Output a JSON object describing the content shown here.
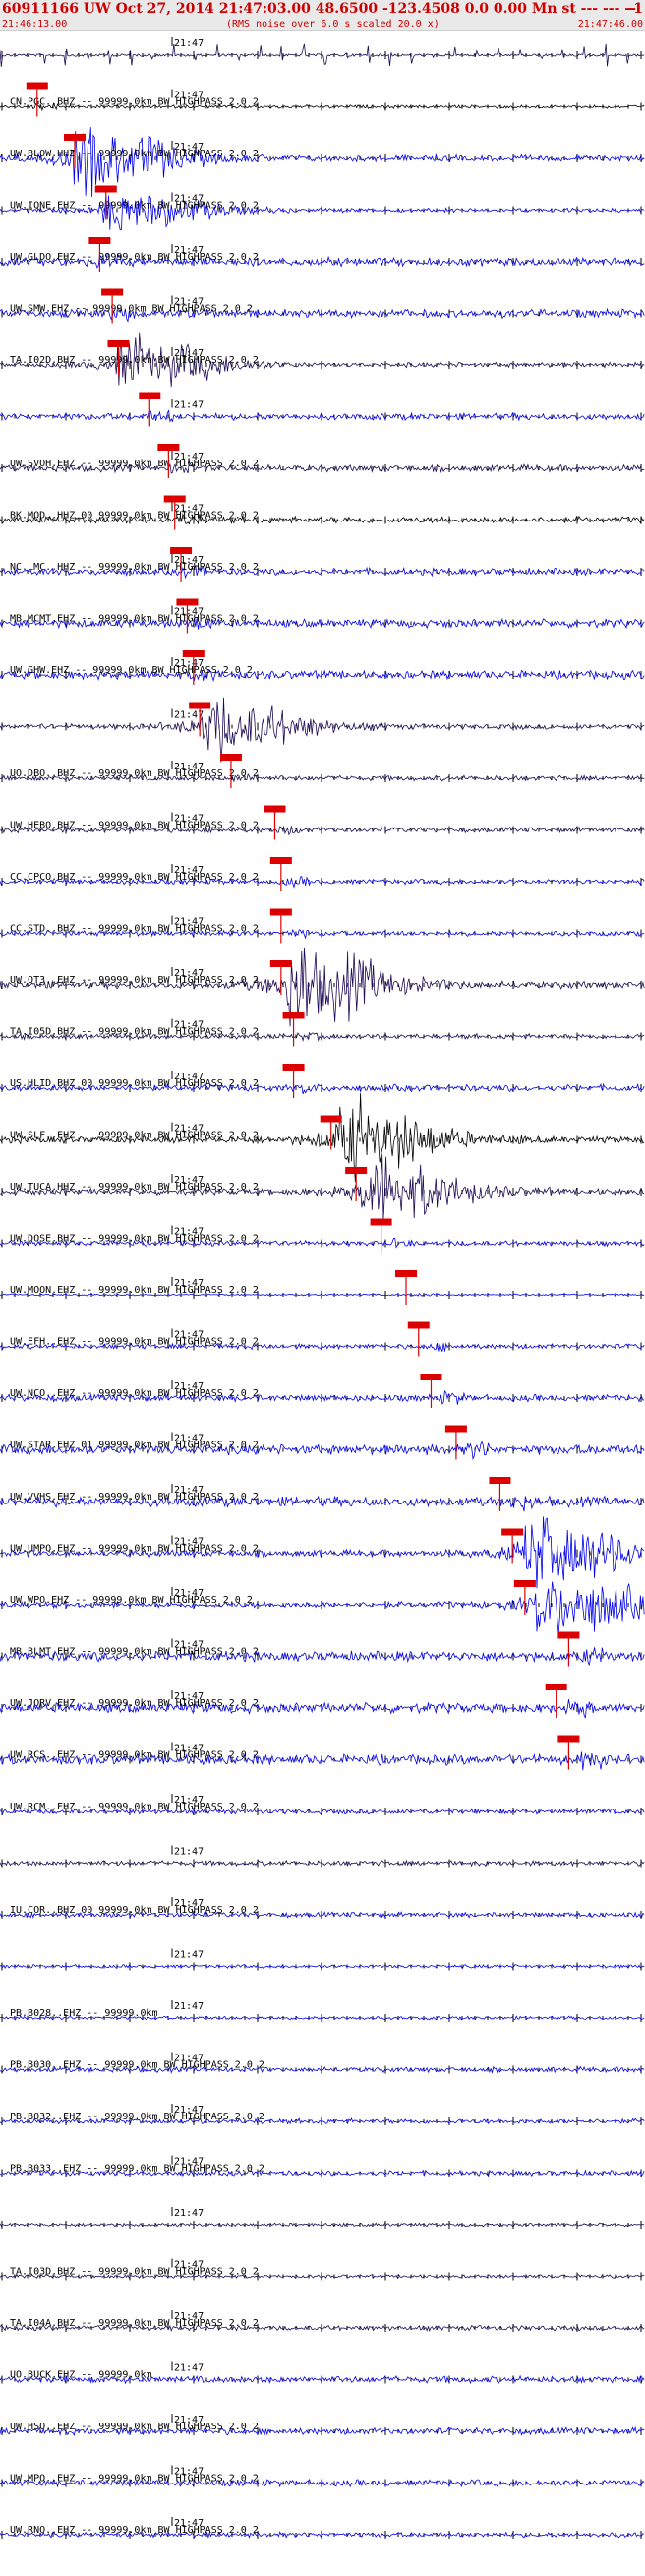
{
  "header": {
    "title": "60911166 UW Oct 27, 2014 21:47:03.00   48.6500 -123.4508  0.0 0.00 Mn st --- --- --",
    "title_right": "-1",
    "start_time": "21:46:13.00",
    "rms_note": "(RMS noise over 6.0 s scaled 20.0 x)",
    "end_time": "21:47:46.00"
  },
  "time_tick_label": "21:47",
  "colors": {
    "blue": "#0000ee",
    "black": "#000000",
    "navy": "#1c0a55",
    "pick": "#dd0000"
  },
  "traces": [
    {
      "label": "",
      "color": "navy",
      "amp": 6,
      "kind": "pulse",
      "pick": null
    },
    {
      "label": "CN.PGC..BHZ -- 99999.0km BW HIGHPASS  2.0  2",
      "color": "black",
      "amp": 2,
      "kind": "noise",
      "pick": 0.05
    },
    {
      "label": "UW.BLOW.HHZ -- 99999.0km BW HIGHPASS  2.0  2",
      "color": "blue",
      "amp": 9,
      "kind": "burst",
      "pick": 0.11
    },
    {
      "label": "UW.IQNE.EHZ -- 99999.0km BW HIGHPASS  2.0  2",
      "color": "blue",
      "amp": 6,
      "kind": "burst",
      "pick": 0.16
    },
    {
      "label": "UW.GLDO.EHZ -- 99999.0km BW HIGHPASS  2.0  2",
      "color": "blue",
      "amp": 5,
      "kind": "noise",
      "pick": 0.15
    },
    {
      "label": "UW.SMW.EHZ -- 99999.0km BW HIGHPASS  2.0  2",
      "color": "blue",
      "amp": 5,
      "kind": "noise",
      "pick": 0.17
    },
    {
      "label": "TA.I02D.BHZ -- 99999.0km BW HIGHPASS  2.0  2",
      "color": "navy",
      "amp": 7,
      "kind": "burst",
      "pick": 0.18
    },
    {
      "label": "",
      "color": "blue",
      "amp": 4,
      "kind": "noise",
      "pick": 0.23
    },
    {
      "label": "UW.SVOH.EHZ -- 99999.0km BW HIGHPASS  2.0  2",
      "color": "navy",
      "amp": 4,
      "kind": "noise",
      "pick": 0.26
    },
    {
      "label": "BK.MOD..HHZ 00 99999.0km BW HIGHPASS  2.0  2",
      "color": "black",
      "amp": 4,
      "kind": "noise",
      "pick": 0.27
    },
    {
      "label": "NC.LMC..HHZ -- 99999.0km BW HIGHPASS  2.0  2",
      "color": "blue",
      "amp": 4,
      "kind": "noise",
      "pick": 0.28
    },
    {
      "label": "MB.MCMT.EHZ -- 99999.0km BW HIGHPASS  2.0  2",
      "color": "blue",
      "amp": 5,
      "kind": "noise",
      "pick": 0.29
    },
    {
      "label": "UW.GHW.EHZ -- 99999.0km BW HIGHPASS  2.0  2",
      "color": "blue",
      "amp": 5,
      "kind": "noise",
      "pick": 0.3
    },
    {
      "label": "",
      "color": "navy",
      "amp": 8,
      "kind": "burst",
      "pick": 0.31
    },
    {
      "label": "UO.DBO..BHZ -- 99999.0km BW HIGHPASS  2.0  2",
      "color": "navy",
      "amp": 3,
      "kind": "noise",
      "pick": 0.36
    },
    {
      "label": "UW.HEBO.BHZ -- 99999.0km BW HIGHPASS  2.0  2",
      "color": "navy",
      "amp": 3,
      "kind": "noise",
      "pick": 0.43
    },
    {
      "label": "CC.CPCO.BHZ -- 99999.0km BW HIGHPASS  2.0  2",
      "color": "blue",
      "amp": 3,
      "kind": "noise",
      "pick": 0.44
    },
    {
      "label": "CC.STD..BHZ -- 99999.0km BW HIGHPASS  2.0  2",
      "color": "blue",
      "amp": 3,
      "kind": "noise",
      "pick": 0.44
    },
    {
      "label": "UW.OT3..EHZ -- 99999.0km BW HIGHPASS  2.0  2",
      "color": "navy",
      "amp": 11,
      "kind": "burst",
      "pick": 0.44
    },
    {
      "label": "TA.I05D.BHZ -- 99999.0km BW HIGHPASS  2.0  2",
      "color": "navy",
      "amp": 3,
      "kind": "noise",
      "pick": 0.46
    },
    {
      "label": "US.HLID.BHZ 00 99999.0km BW HIGHPASS  2.0  2",
      "color": "blue",
      "amp": 4,
      "kind": "noise",
      "pick": 0.46
    },
    {
      "label": "UW.SLF..EHZ -- 99999.0km BW HIGHPASS  2.0  2",
      "color": "black",
      "amp": 10,
      "kind": "burst",
      "pick": 0.52
    },
    {
      "label": "UW.TUCA.HHZ -- 99999.0km BW HIGHPASS  2.0  2",
      "color": "navy",
      "amp": 9,
      "kind": "burst",
      "pick": 0.56
    },
    {
      "label": "UW.DOSE.BHZ -- 99999.0km BW HIGHPASS  2.0  2",
      "color": "blue",
      "amp": 3,
      "kind": "noise",
      "pick": 0.6
    },
    {
      "label": "UW.MOON.EHZ -- 99999.0km BW HIGHPASS  2.0  2",
      "color": "blue",
      "amp": 2,
      "kind": "flat",
      "pick": 0.64
    },
    {
      "label": "UW.EFH..EHZ -- 99999.0km BW HIGHPASS  2.0  2",
      "color": "blue",
      "amp": 3,
      "kind": "noise",
      "pick": 0.66
    },
    {
      "label": "UW.NCO..EHZ -- 99999.0km BW HIGHPASS  2.0  2",
      "color": "blue",
      "amp": 4,
      "kind": "noise",
      "pick": 0.68
    },
    {
      "label": "UW.STAR.EHZ 01 99999.0km BW HIGHPASS  2.0  2",
      "color": "blue",
      "amp": 6,
      "kind": "noise",
      "pick": 0.72
    },
    {
      "label": "UW.VVHS.EHZ -- 99999.0km BW HIGHPASS  2.0  2",
      "color": "blue",
      "amp": 6,
      "kind": "noise",
      "pick": 0.79
    },
    {
      "label": "UW.UMPQ.EHZ -- 99999.0km BW HIGHPASS  2.0  2",
      "color": "blue",
      "amp": 10,
      "kind": "burst",
      "pick": 0.81
    },
    {
      "label": "UW.WPO.EHZ -- 99999.0km BW HIGHPASS  2.0  2",
      "color": "blue",
      "amp": 9,
      "kind": "burst",
      "pick": 0.83
    },
    {
      "label": "MB.BLMT.EHZ -- 99999.0km BW HIGHPASS  2.0  2",
      "color": "blue",
      "amp": 6,
      "kind": "noise",
      "pick": 0.9
    },
    {
      "label": "UW.JORV.EHZ -- 99999.0km BW HIGHPASS  2.0  2",
      "color": "blue",
      "amp": 6,
      "kind": "noise",
      "pick": 0.88
    },
    {
      "label": "UW.RCS..EHZ -- 99999.0km BW HIGHPASS  2.0  2",
      "color": "blue",
      "amp": 6,
      "kind": "noise",
      "pick": 0.9
    },
    {
      "label": "UW.RCM..EHZ -- 99999.0km BW HIGHPASS  2.0  2",
      "color": "blue",
      "amp": 3,
      "kind": "noise",
      "pick": null
    },
    {
      "label": "",
      "color": "navy",
      "amp": 3,
      "kind": "noise",
      "pick": null
    },
    {
      "label": "IU.COR..BHZ 00 99999.0km BW HIGHPASS  2.0  2",
      "color": "blue",
      "amp": 3,
      "kind": "noise",
      "pick": null
    },
    {
      "label": "",
      "color": "blue",
      "amp": 2,
      "kind": "noise",
      "pick": null
    },
    {
      "label": "PB.B028..EHZ -- 99999.0km",
      "color": "blue",
      "amp": 2,
      "kind": "noise",
      "pick": null
    },
    {
      "label": "PB.B030..EHZ -- 99999.0km BW HIGHPASS  2.0  2",
      "color": "blue",
      "amp": 3,
      "kind": "noise",
      "pick": null
    },
    {
      "label": "PB.B032..EHZ -- 99999.0km BW HIGHPASS  2.0  2",
      "color": "blue",
      "amp": 3,
      "kind": "noise",
      "pick": null
    },
    {
      "label": "PB.B033..EHZ -- 99999.0km BW HIGHPASS  2.0  2",
      "color": "blue",
      "amp": 3,
      "kind": "noise",
      "pick": null
    },
    {
      "label": "",
      "color": "navy",
      "amp": 2,
      "kind": "noise",
      "pick": null
    },
    {
      "label": "TA.I03D.BHZ -- 99999.0km BW HIGHPASS  2.0  2",
      "color": "navy",
      "amp": 2,
      "kind": "noise",
      "pick": null
    },
    {
      "label": "TA.I04A.BHZ -- 99999.0km BW HIGHPASS  2.0  2",
      "color": "navy",
      "amp": 3,
      "kind": "noise",
      "pick": null
    },
    {
      "label": "UO.BUCK.EHZ -- 99999.0km",
      "color": "blue",
      "amp": 4,
      "kind": "noise",
      "pick": null
    },
    {
      "label": "UW.HSO..EHZ -- 99999.0km BW HIGHPASS  2.0  2",
      "color": "blue",
      "amp": 4,
      "kind": "noise",
      "pick": null
    },
    {
      "label": "UW.MPO..EHZ -- 99999.0km BW HIGHPASS  2.0  2",
      "color": "blue",
      "amp": 4,
      "kind": "noise",
      "pick": null
    },
    {
      "label": "UW.RNO..EHZ -- 99999.0km BW HIGHPASS  2.0  2",
      "color": "blue",
      "amp": 3,
      "kind": "noise",
      "pick": null
    }
  ]
}
